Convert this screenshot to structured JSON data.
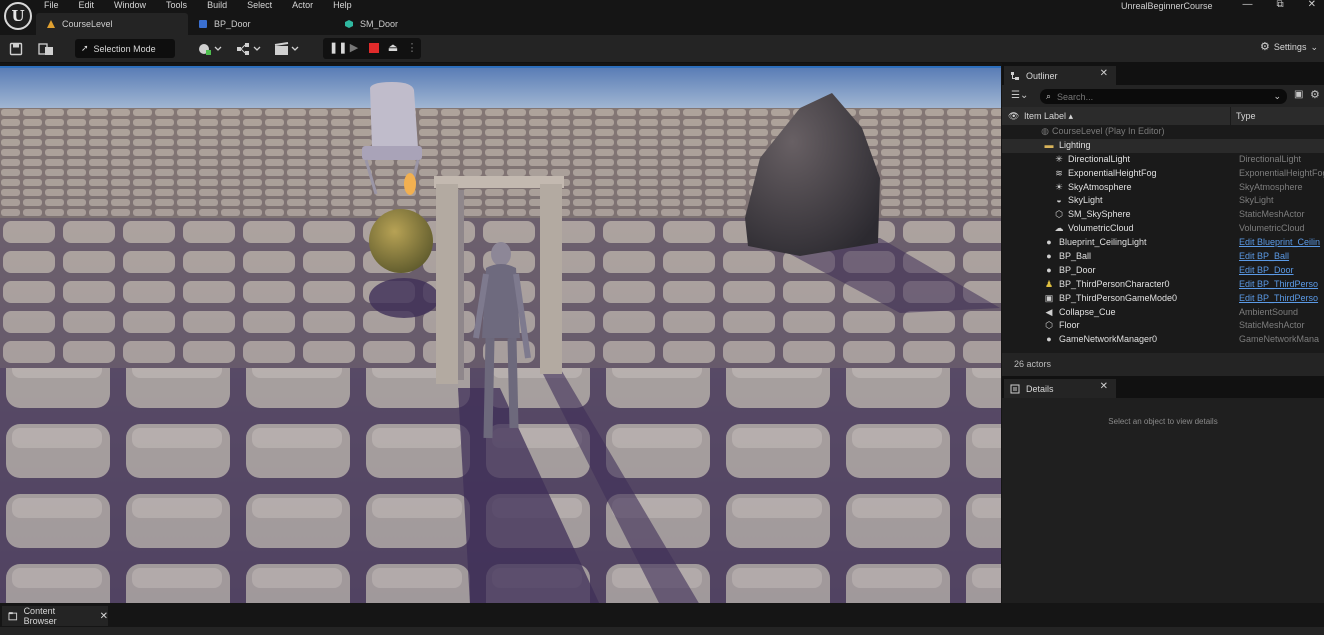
{
  "app": {
    "logo_glyph": "U",
    "project_name": "UnrealBeginnerCourse",
    "menu": [
      "File",
      "Edit",
      "Window",
      "Tools",
      "Build",
      "Select",
      "Actor",
      "Help"
    ],
    "window_controls": {
      "minimize": "—",
      "maximize": "⧉",
      "close": "✕"
    }
  },
  "tabs": [
    {
      "label": "CourseLevel",
      "icon": "level-icon",
      "active": true
    },
    {
      "label": "BP_Door",
      "icon": "blueprint-icon",
      "active": false
    },
    {
      "label": "SM_Door",
      "icon": "static-mesh-icon",
      "active": false
    }
  ],
  "toolbar": {
    "selection_mode": "Selection Mode",
    "settings": "Settings"
  },
  "outliner": {
    "tab_label": "Outliner",
    "search_placeholder": "Search...",
    "columns": {
      "label": "Item Label ▴",
      "type": "Type"
    },
    "rows": [
      {
        "label": "CourseLevel (Play In Editor)",
        "type": "",
        "indent": 0,
        "icon": "world-icon",
        "dim": true
      },
      {
        "label": "Lighting",
        "type": "",
        "indent": 1,
        "icon": "folder-icon",
        "folder": true
      },
      {
        "label": "DirectionalLight",
        "type": "DirectionalLight",
        "indent": 2,
        "icon": "directional-light-icon"
      },
      {
        "label": "ExponentialHeightFog",
        "type": "ExponentialHeightFog",
        "indent": 2,
        "icon": "fog-icon"
      },
      {
        "label": "SkyAtmosphere",
        "type": "SkyAtmosphere",
        "indent": 2,
        "icon": "sky-atmosphere-icon"
      },
      {
        "label": "SkyLight",
        "type": "SkyLight",
        "indent": 2,
        "icon": "sky-light-icon"
      },
      {
        "label": "SM_SkySphere",
        "type": "StaticMeshActor",
        "indent": 2,
        "icon": "static-mesh-icon"
      },
      {
        "label": "VolumetricCloud",
        "type": "VolumetricCloud",
        "indent": 2,
        "icon": "cloud-icon"
      },
      {
        "label": "Blueprint_CeilingLight",
        "type": "Edit Blueprint_Ceilin",
        "indent": 1,
        "icon": "light-bulb-icon",
        "link": true
      },
      {
        "label": "BP_Ball",
        "type": "Edit BP_Ball",
        "indent": 1,
        "icon": "actor-icon",
        "link": true
      },
      {
        "label": "BP_Door",
        "type": "Edit BP_Door",
        "indent": 1,
        "icon": "actor-icon",
        "link": true
      },
      {
        "label": "BP_ThirdPersonCharacter0",
        "type": "Edit BP_ThirdPerso",
        "indent": 1,
        "icon": "character-icon",
        "link": true
      },
      {
        "label": "BP_ThirdPersonGameMode0",
        "type": "Edit BP_ThirdPerso",
        "indent": 1,
        "icon": "game-mode-icon",
        "link": true
      },
      {
        "label": "Collapse_Cue",
        "type": "AmbientSound",
        "indent": 1,
        "icon": "speaker-icon"
      },
      {
        "label": "Floor",
        "type": "StaticMeshActor",
        "indent": 1,
        "icon": "static-mesh-icon"
      },
      {
        "label": "GameNetworkManager0",
        "type": "GameNetworkMana",
        "indent": 1,
        "icon": "actor-icon"
      }
    ],
    "actor_count": "26 actors"
  },
  "details": {
    "tab_label": "Details",
    "empty_message": "Select an object to view details"
  },
  "content_browser": {
    "tab_label": "Content Browser"
  }
}
